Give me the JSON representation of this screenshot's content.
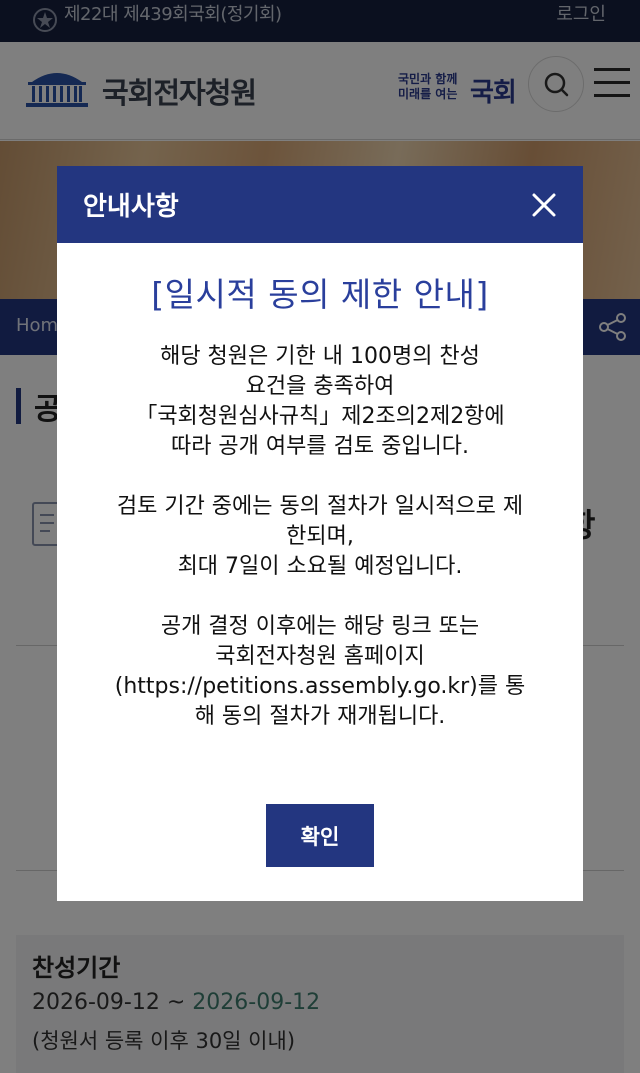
{
  "topbar": {
    "session": "제22대 제439회국회(정기회)",
    "login": "로그인",
    "emblem_icon": "national-assembly-emblem-icon"
  },
  "header": {
    "logo_text": "국회전자청원",
    "slogan_small": "국민과 함께 미래를 여는",
    "slogan_big": "국회",
    "search_icon": "search-icon",
    "menu_icon": "hamburger-menu-icon"
  },
  "hero": {
    "home_label": "Hom",
    "share_icon": "share-icon"
  },
  "page": {
    "title_fragment": "공",
    "side_fragment": "항"
  },
  "period": {
    "title": "찬성기간",
    "start": "2026-09-12",
    "separator": " ~ ",
    "end": "2026-09-12",
    "note": "(청원서 등록 이후 30일 이내)"
  },
  "modal": {
    "title": "안내사항",
    "close_icon": "close-icon",
    "subtitle": "[일시적 동의 제한 안내]",
    "para1": [
      "해당 청원은 기한 내 100명의 찬성",
      "요건을 충족하여",
      "「국회청원심사규칙」제2조의2제2항에",
      "따라 공개 여부를 검토 중입니다."
    ],
    "para2": [
      "검토 기간 중에는 동의 절차가 일시적으로 제",
      "한되며,",
      "최대 7일이 소요될 예정입니다."
    ],
    "para3": [
      "공개 결정 이후에는 해당 링크 또는",
      "국회전자청원 홈페이지",
      "(https://petitions.assembly.go.kr)를 통",
      "해 동의 절차가 재개됩니다."
    ],
    "confirm_label": "확인"
  },
  "colors": {
    "navy": "#233680",
    "topbar": "#16213f",
    "subtitle": "#2a3f9c",
    "date_end": "#3f7d6e"
  }
}
